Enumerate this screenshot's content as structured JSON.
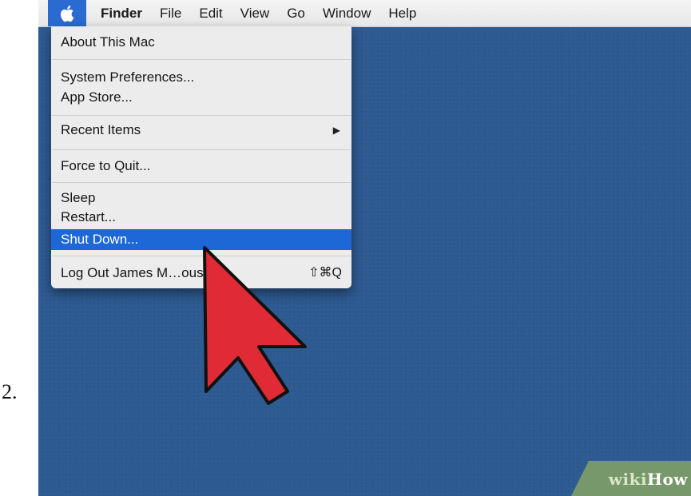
{
  "step": {
    "number": "2."
  },
  "menubar": {
    "apple_icon": "apple-logo-icon",
    "items": [
      {
        "label": "Finder"
      },
      {
        "label": "File"
      },
      {
        "label": "Edit"
      },
      {
        "label": "View"
      },
      {
        "label": "Go"
      },
      {
        "label": "Window"
      },
      {
        "label": "Help"
      }
    ]
  },
  "apple_menu": {
    "items": [
      {
        "label": "About This Mac"
      },
      {
        "label": "System Preferences..."
      },
      {
        "label": "App Store..."
      },
      {
        "label": "Recent Items",
        "submenu_icon": "triangle-right-icon"
      },
      {
        "label": "Force to Quit..."
      },
      {
        "label": "Sleep"
      },
      {
        "label": "Restart..."
      },
      {
        "label": "Shut Down...",
        "highlighted": true
      },
      {
        "label": "Log Out James M…ous...",
        "shortcut": "⇧⌘Q"
      }
    ]
  },
  "overlay": {
    "cursor_icon": "red-arrow-cursor-icon",
    "cursor_color": "#e02a35"
  },
  "watermark": {
    "part1": "wiki",
    "part2": "How"
  },
  "colors": {
    "desktop": "#2d5a91",
    "highlight": "#1d67d6",
    "apple_slot": "#2a6bd1",
    "menu_bg": "#ececec"
  }
}
